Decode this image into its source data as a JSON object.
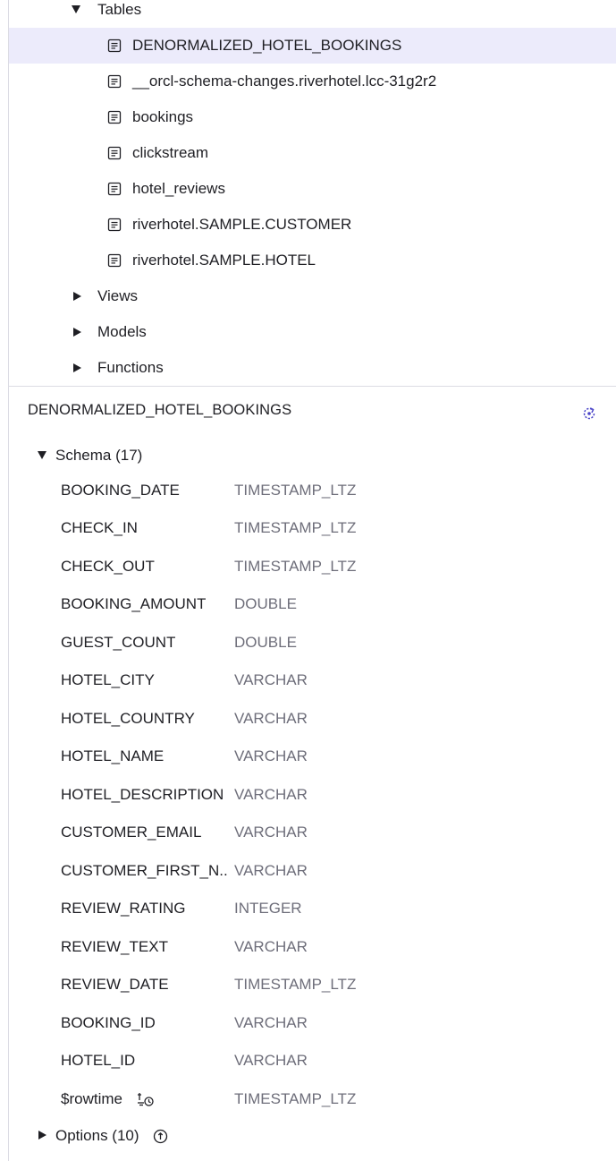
{
  "tree": {
    "tables_label": "Tables",
    "tables": [
      "DENORMALIZED_HOTEL_BOOKINGS",
      "__orcl-schema-changes.riverhotel.lcc-31g2r2",
      "bookings",
      "clickstream",
      "hotel_reviews",
      "riverhotel.SAMPLE.CUSTOMER",
      "riverhotel.SAMPLE.HOTEL"
    ],
    "views_label": "Views",
    "models_label": "Models",
    "functions_label": "Functions"
  },
  "detail": {
    "title": "DENORMALIZED_HOTEL_BOOKINGS",
    "schema_label": "Schema (17)",
    "columns": [
      {
        "name": "BOOKING_DATE",
        "type": "TIMESTAMP_LTZ"
      },
      {
        "name": "CHECK_IN",
        "type": "TIMESTAMP_LTZ"
      },
      {
        "name": "CHECK_OUT",
        "type": "TIMESTAMP_LTZ"
      },
      {
        "name": "BOOKING_AMOUNT",
        "type": "DOUBLE"
      },
      {
        "name": "GUEST_COUNT",
        "type": "DOUBLE"
      },
      {
        "name": "HOTEL_CITY",
        "type": "VARCHAR"
      },
      {
        "name": "HOTEL_COUNTRY",
        "type": "VARCHAR"
      },
      {
        "name": "HOTEL_NAME",
        "type": "VARCHAR"
      },
      {
        "name": "HOTEL_DESCRIPTION",
        "type": "VARCHAR"
      },
      {
        "name": "CUSTOMER_EMAIL",
        "type": "VARCHAR"
      },
      {
        "name": "CUSTOMER_FIRST_N...",
        "type": "VARCHAR"
      },
      {
        "name": "REVIEW_RATING",
        "type": "INTEGER"
      },
      {
        "name": "REVIEW_TEXT",
        "type": "VARCHAR"
      },
      {
        "name": "REVIEW_DATE",
        "type": "TIMESTAMP_LTZ"
      },
      {
        "name": "BOOKING_ID",
        "type": "VARCHAR"
      },
      {
        "name": "HOTEL_ID",
        "type": "VARCHAR"
      },
      {
        "name": "$rowtime",
        "type": "TIMESTAMP_LTZ"
      }
    ],
    "options_label": "Options (10)"
  },
  "colors": {
    "selected_row": "#ecebfb",
    "accent": "#4a44c8",
    "muted_text": "#6e6e7a"
  },
  "icons": {
    "table": "table-doc-icon",
    "refresh": "refresh-icon",
    "rowtime": "watermark-clock-icon",
    "info": "info-circle-icon"
  }
}
